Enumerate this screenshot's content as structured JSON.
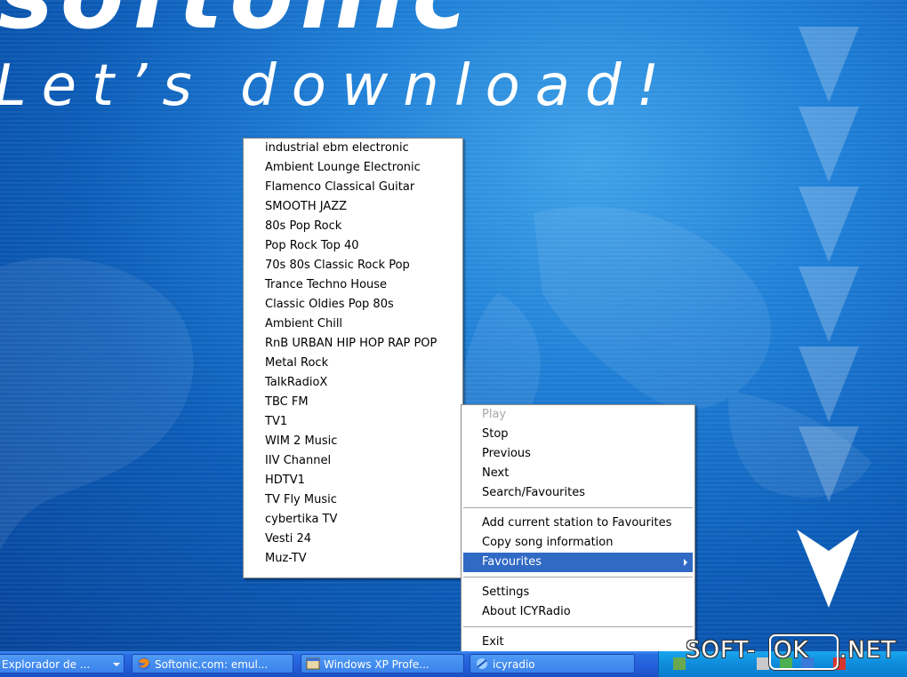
{
  "desktop": {
    "brand_name": "softonic",
    "tagline": "Let’s download!"
  },
  "favourites_menu": {
    "items": [
      "industrial ebm electronic",
      "Ambient Lounge Electronic",
      "Flamenco Classical Guitar",
      "SMOOTH JAZZ",
      "80s Pop Rock",
      "Pop Rock Top 40",
      "70s 80s Classic Rock Pop",
      "Trance Techno House",
      "Classic Oldies Pop 80s",
      "Ambient Chill",
      "RnB URBAN HIP HOP RAP POP",
      "Metal  Rock",
      "TalkRadioX",
      "TBC FM",
      "TV1",
      "WIM 2 Music",
      "IIV Channel",
      "HDTV1",
      "TV Fly Music",
      "cybertika TV",
      "Vesti 24",
      "Muz-TV"
    ]
  },
  "context_menu": {
    "play": "Play",
    "stop": "Stop",
    "previous": "Previous",
    "next": "Next",
    "search_favourites": "Search/Favourites",
    "add_station": "Add current station to Favourites",
    "copy_song": "Copy song information",
    "favourites": "Favourites",
    "settings": "Settings",
    "about": "About ICYRadio",
    "exit": "Exit"
  },
  "taskbar": {
    "buttons": [
      {
        "label": "Explorador de ...",
        "icon": "folder-icon"
      },
      {
        "label": "Softonic.com: emul...",
        "icon": "firefox-icon"
      },
      {
        "label": "Windows XP Profe...",
        "icon": "window-icon"
      },
      {
        "label": "icyradio",
        "icon": "radio-icon"
      }
    ]
  },
  "watermark": {
    "part1": "SOFT-",
    "part2": "OK",
    "part3": ".NET"
  },
  "colors": {
    "menu_highlight": "#316ac5",
    "taskbar": "#245edb",
    "tray": "#0e8bdb"
  }
}
